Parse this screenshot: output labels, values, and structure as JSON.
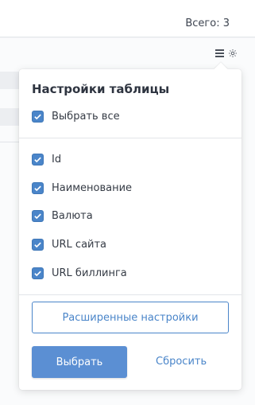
{
  "header": {
    "total_label": "Всего: 3"
  },
  "toolbar": {
    "menu_icon": "hamburger-icon",
    "gear_icon": "gear-icon"
  },
  "settings": {
    "title": "Настройки таблицы",
    "select_all": {
      "label": "Выбрать все",
      "checked": true
    },
    "columns": [
      {
        "label": "Id",
        "checked": true
      },
      {
        "label": "Наименование",
        "checked": true
      },
      {
        "label": "Валюта",
        "checked": true
      },
      {
        "label": "URL сайта",
        "checked": true
      },
      {
        "label": "URL биллинга",
        "checked": true
      }
    ],
    "advanced_button": "Расширенные настройки",
    "apply_button": "Выбрать",
    "reset_link": "Сбросить"
  },
  "colors": {
    "accent": "#4a85c9",
    "primary_button": "#5b8fd3"
  }
}
